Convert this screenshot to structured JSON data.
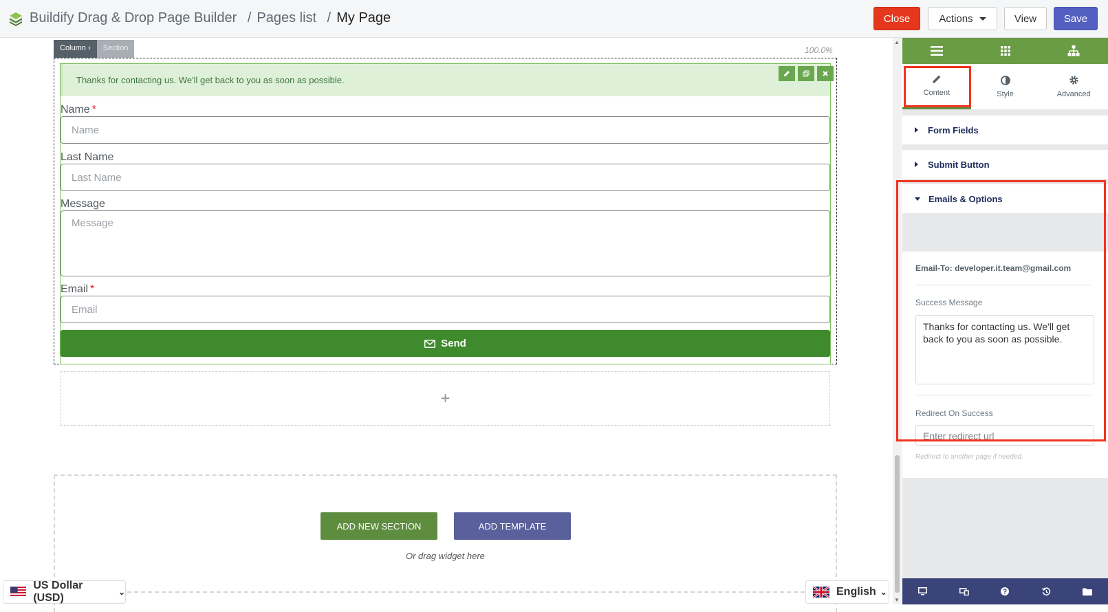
{
  "header": {
    "app_title": "Buildify Drag & Drop Page Builder",
    "sep1": "/",
    "crumb_pages": "Pages list",
    "sep2": "/",
    "crumb_current": "My Page",
    "close_label": "Close",
    "actions_label": "Actions",
    "view_label": "View",
    "save_label": "Save",
    "close_color": "#e5371b",
    "save_color": "#5360c2"
  },
  "canvas": {
    "handle_column": "Column ›",
    "handle_section": "Section",
    "zoom": "100.0%",
    "success_alert": "Thanks for contacting us. We'll get back to you as soon as possible.",
    "form": {
      "name_label": "Name",
      "name_placeholder": "Name",
      "lastname_label": "Last Name",
      "lastname_placeholder": "Last Name",
      "message_label": "Message",
      "message_placeholder": "Message",
      "email_label": "Email",
      "email_placeholder": "Email",
      "required_mark": "*",
      "send_label": "Send"
    },
    "add_widget_glyph": "+",
    "add_section_label": "ADD NEW SECTION",
    "add_template_label": "ADD TEMPLATE",
    "drag_hint": "Or drag widget here"
  },
  "footer": {
    "currency": "US Dollar (USD)",
    "language": "English"
  },
  "panel": {
    "top_icons": [
      "menu-icon",
      "widgets-grid-icon",
      "navigator-icon"
    ],
    "tabs": [
      {
        "label": "Content",
        "icon": "pencil-icon",
        "active": true
      },
      {
        "label": "Style",
        "icon": "half-circle-icon",
        "active": false
      },
      {
        "label": "Advanced",
        "icon": "gear-icon",
        "active": false
      }
    ],
    "sections": {
      "form_fields": "Form Fields",
      "submit_button": "Submit Button",
      "emails_options": "Emails & Options"
    },
    "email_to": "Email-To: developer.it.team@gmail.com",
    "success_message_label": "Success Message",
    "success_message_value": "Thanks for contacting us. We'll get back to you as soon as possible.",
    "redirect_label": "Redirect On Success",
    "redirect_placeholder": "Enter redirect url",
    "redirect_hint": "Redirect to another page if needed.",
    "footer_icons": [
      "desktop-icon",
      "responsive-icon",
      "help-icon",
      "history-icon",
      "folder-icon"
    ],
    "accent_color": "#6a9c45",
    "footer_color": "#3a4478"
  }
}
